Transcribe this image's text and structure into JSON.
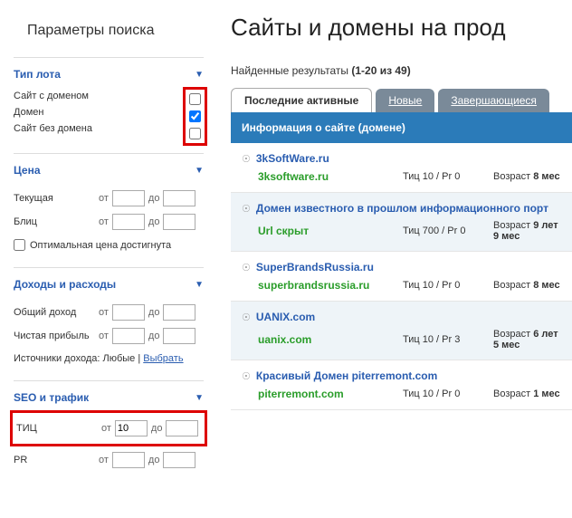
{
  "sidebar": {
    "title": "Параметры поиска",
    "sections": {
      "lot_type": {
        "title": "Тип лота",
        "items": [
          {
            "label": "Сайт с доменом",
            "checked": false
          },
          {
            "label": "Домен",
            "checked": true
          },
          {
            "label": "Сайт без домена",
            "checked": false
          }
        ]
      },
      "price": {
        "title": "Цена",
        "rows": [
          {
            "label": "Текущая",
            "from": "",
            "to": ""
          },
          {
            "label": "Блиц",
            "from": "",
            "to": ""
          }
        ],
        "optimal_label": "Оптимальная цена достигнута",
        "from_label": "от",
        "to_label": "до"
      },
      "income": {
        "title": "Доходы и расходы",
        "rows": [
          {
            "label": "Общий доход",
            "from": "",
            "to": ""
          },
          {
            "label": "Чистая прибыль",
            "from": "",
            "to": ""
          }
        ],
        "sources_label": "Источники дохода:",
        "sources_value": "Любые",
        "sources_link": "Выбрать"
      },
      "seo": {
        "title": "SEO и трафик",
        "rows": [
          {
            "label": "ТИЦ",
            "from": "10",
            "to": ""
          },
          {
            "label": "PR",
            "from": "",
            "to": ""
          }
        ]
      }
    }
  },
  "main": {
    "title": "Сайты и домены на прод",
    "results_label": "Найденные результаты",
    "results_count": "(1-20 из 49)",
    "tabs": [
      {
        "label": "Последние активные",
        "active": true
      },
      {
        "label": "Новые",
        "active": false
      },
      {
        "label": "Завершающиеся",
        "active": false
      }
    ],
    "table_header": "Информация о сайте (домене)",
    "listings": [
      {
        "name": "3kSoftWare.ru",
        "domain": "3ksoftware.ru",
        "tic": "Тиц 10 / Pr 0",
        "age_label": "Возраст",
        "age": "8 мес"
      },
      {
        "name": "Домен известного в прошлом информационного порт",
        "domain": "Url скрыт",
        "tic": "Тиц 700 / Pr 0",
        "age_label": "Возраст",
        "age": "9 лет 9 мес"
      },
      {
        "name": "SuperBrandsRussia.ru",
        "domain": "superbrandsrussia.ru",
        "tic": "Тиц 10 / Pr 0",
        "age_label": "Возраст",
        "age": "8 мес"
      },
      {
        "name": "UANIX.com",
        "domain": "uanix.com",
        "tic": "Тиц 10 / Pr 3",
        "age_label": "Возраст",
        "age": "6 лет 5 мес"
      },
      {
        "name": "Красивый Домен piterremont.com",
        "domain": "piterremont.com",
        "tic": "Тиц 10 / Pr 0",
        "age_label": "Возраст",
        "age": "1 мес"
      }
    ]
  }
}
